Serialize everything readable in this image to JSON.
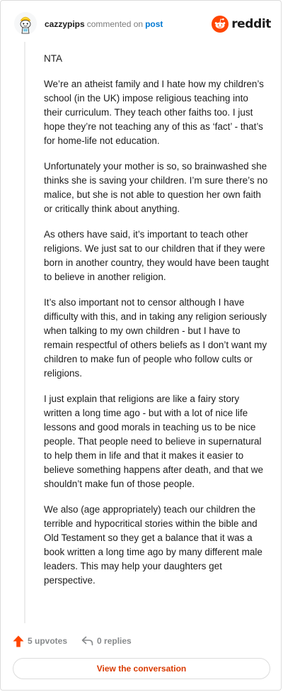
{
  "comment": {
    "author": "cazzypips",
    "action_text": "commented on",
    "post_link_text": "post",
    "paragraphs": [
      "NTA",
      "We’re an atheist family and I hate how my children’s school (in the UK) impose religious teaching into their curriculum. They teach other faiths too. I just hope they’re not teaching any of this as ‘fact’ - that’s for home-life not education.",
      "Unfortunately your mother is so, so brainwashed she thinks she is saving your children. I’m sure there’s no malice, but she is not able to question her own faith or critically think about anything.",
      "As others have said, it’s important to teach other religions. We just sat to our children that if they were born in another country, they would have been taught to believe in another religion.",
      "It’s also important not to censor although I have difficulty with this, and in taking any religion seriously when talking to my own children - but I have to remain respectful of others beliefs as I don’t want my children to make fun of people who follow cults or religions.",
      "I just explain that religions are like a fairy story written a long time ago - but with a lot of nice life lessons and good morals in teaching us to be nice people. That people need to believe in supernatural to help them in life and that it makes it easier to believe something happens after death, and that we shouldn’t make fun of those people.",
      "We also (age appropriately) teach our children the terrible and hypocritical stories within the bible and Old Testament so they get a balance that it was a book written a long time ago by many different male leaders. This may help your daughters get perspective."
    ]
  },
  "brand": {
    "wordmark": "reddit",
    "icon": "reddit-snoo-icon",
    "color": "#ff4500"
  },
  "actions": {
    "upvotes_label": "5 upvotes",
    "replies_label": "0 replies",
    "upvote_icon": "upvote-arrow-icon",
    "reply_icon": "reply-arrow-icon"
  },
  "cta": {
    "label": "View the conversation"
  },
  "colors": {
    "link_blue": "#0079d3",
    "upvote_orange": "#ff4500",
    "cta_text": "#d93a00",
    "muted_text": "#878a8c"
  }
}
